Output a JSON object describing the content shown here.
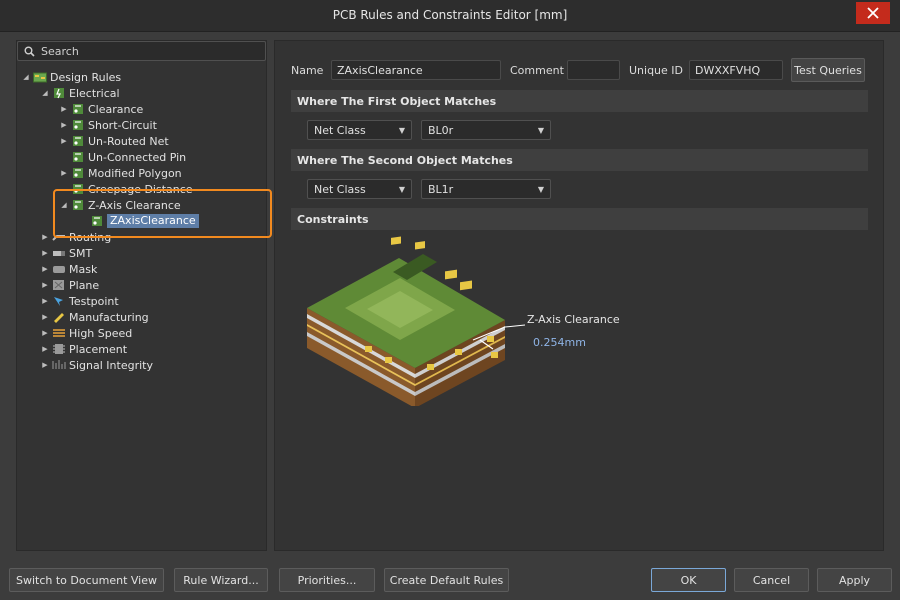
{
  "window": {
    "title": "PCB Rules and Constraints Editor [mm]"
  },
  "search": {
    "placeholder": "Search"
  },
  "tree": [
    {
      "label": "Design Rules",
      "level": 0,
      "expanded": true,
      "icon": "design-rules-icon"
    },
    {
      "label": "Electrical",
      "level": 1,
      "expanded": true,
      "icon": "electrical-icon"
    },
    {
      "label": "Clearance",
      "level": 2,
      "expanded": false,
      "icon": "rule-icon"
    },
    {
      "label": "Short-Circuit",
      "level": 2,
      "expanded": false,
      "icon": "rule-icon"
    },
    {
      "label": "Un-Routed Net",
      "level": 2,
      "expanded": false,
      "icon": "rule-icon"
    },
    {
      "label": "Un-Connected Pin",
      "level": 2,
      "expanded": null,
      "icon": "rule-icon"
    },
    {
      "label": "Modified Polygon",
      "level": 2,
      "expanded": false,
      "icon": "rule-icon"
    },
    {
      "label": "Creepage Distance",
      "level": 2,
      "expanded": null,
      "icon": "rule-icon"
    },
    {
      "label": "Z-Axis Clearance",
      "level": 2,
      "expanded": true,
      "icon": "rule-icon"
    },
    {
      "label": "ZAxisClearance",
      "level": 3,
      "expanded": null,
      "icon": "rule-icon",
      "selected": true
    },
    {
      "label": "Routing",
      "level": 1,
      "expanded": false,
      "icon": "routing-icon"
    },
    {
      "label": "SMT",
      "level": 1,
      "expanded": false,
      "icon": "smt-icon"
    },
    {
      "label": "Mask",
      "level": 1,
      "expanded": false,
      "icon": "mask-icon"
    },
    {
      "label": "Plane",
      "level": 1,
      "expanded": false,
      "icon": "plane-icon"
    },
    {
      "label": "Testpoint",
      "level": 1,
      "expanded": false,
      "icon": "testpoint-icon"
    },
    {
      "label": "Manufacturing",
      "level": 1,
      "expanded": false,
      "icon": "manufacturing-icon"
    },
    {
      "label": "High Speed",
      "level": 1,
      "expanded": false,
      "icon": "high-speed-icon"
    },
    {
      "label": "Placement",
      "level": 1,
      "expanded": false,
      "icon": "placement-icon"
    },
    {
      "label": "Signal Integrity",
      "level": 1,
      "expanded": false,
      "icon": "signal-integrity-icon"
    }
  ],
  "rule": {
    "name_label": "Name",
    "name_value": "ZAxisClearance",
    "comment_label": "Comment",
    "comment_value": "",
    "uid_label": "Unique ID",
    "uid_value": "DWXXFVHQ",
    "test_queries": "Test Queries"
  },
  "first_match": {
    "heading": "Where The First Object Matches",
    "type": "Net Class",
    "value": "BL0r"
  },
  "second_match": {
    "heading": "Where The Second Object Matches",
    "type": "Net Class",
    "value": "BL1r"
  },
  "constraints": {
    "heading": "Constraints",
    "label": "Z-Axis Clearance",
    "value": "0.254mm"
  },
  "buttons": {
    "switch_view": "Switch to Document View",
    "rule_wizard": "Rule Wizard...",
    "priorities": "Priorities...",
    "create_default": "Create Default Rules",
    "ok": "OK",
    "cancel": "Cancel",
    "apply": "Apply"
  },
  "colors": {
    "highlight": "#f28a1f",
    "selection": "#5e7ea7",
    "close": "#c42b1c",
    "value": "#8fb4e6"
  }
}
